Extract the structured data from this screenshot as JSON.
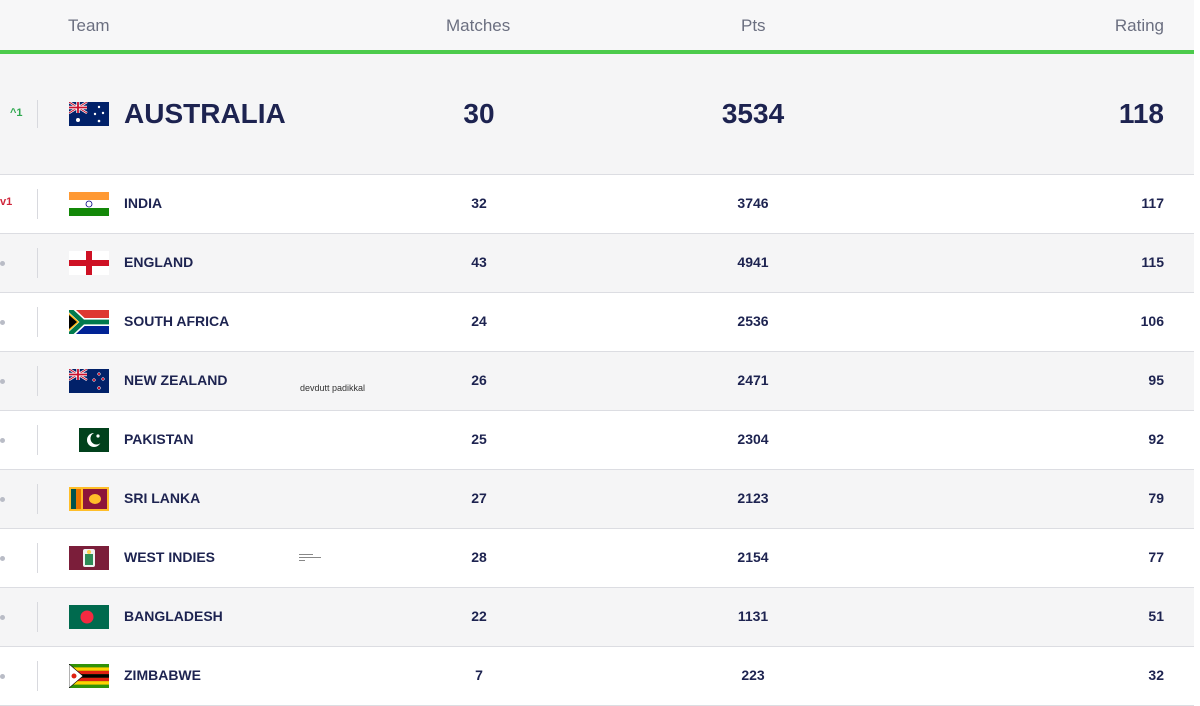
{
  "header": {
    "team": "Team",
    "matches": "Matches",
    "pts": "Pts",
    "rating": "Rating"
  },
  "accent_color": "#4ccb4c",
  "rows": [
    {
      "team": "AUSTRALIA",
      "matches": "30",
      "pts": "3534",
      "rating": "118",
      "change": "^1",
      "change_dir": "up",
      "flag": "australia-flag"
    },
    {
      "team": "INDIA",
      "matches": "32",
      "pts": "3746",
      "rating": "117",
      "change": "v1",
      "change_dir": "down",
      "flag": "india-flag"
    },
    {
      "team": "ENGLAND",
      "matches": "43",
      "pts": "4941",
      "rating": "115",
      "change": "",
      "change_dir": "none",
      "flag": "england-flag"
    },
    {
      "team": "SOUTH AFRICA",
      "matches": "24",
      "pts": "2536",
      "rating": "106",
      "change": "",
      "change_dir": "none",
      "flag": "south-africa-flag"
    },
    {
      "team": "NEW ZEALAND",
      "matches": "26",
      "pts": "2471",
      "rating": "95",
      "change": "",
      "change_dir": "none",
      "flag": "new-zealand-flag"
    },
    {
      "team": "PAKISTAN",
      "matches": "25",
      "pts": "2304",
      "rating": "92",
      "change": "",
      "change_dir": "none",
      "flag": "pakistan-flag"
    },
    {
      "team": "SRI LANKA",
      "matches": "27",
      "pts": "2123",
      "rating": "79",
      "change": "",
      "change_dir": "none",
      "flag": "sri-lanka-flag"
    },
    {
      "team": "WEST INDIES",
      "matches": "28",
      "pts": "2154",
      "rating": "77",
      "change": "",
      "change_dir": "none",
      "flag": "west-indies-flag"
    },
    {
      "team": "BANGLADESH",
      "matches": "22",
      "pts": "1131",
      "rating": "51",
      "change": "",
      "change_dir": "none",
      "flag": "bangladesh-flag"
    },
    {
      "team": "ZIMBABWE",
      "matches": "7",
      "pts": "223",
      "rating": "32",
      "change": "",
      "change_dir": "none",
      "flag": "zimbabwe-flag"
    }
  ],
  "annotation": "devdutt padikkal"
}
